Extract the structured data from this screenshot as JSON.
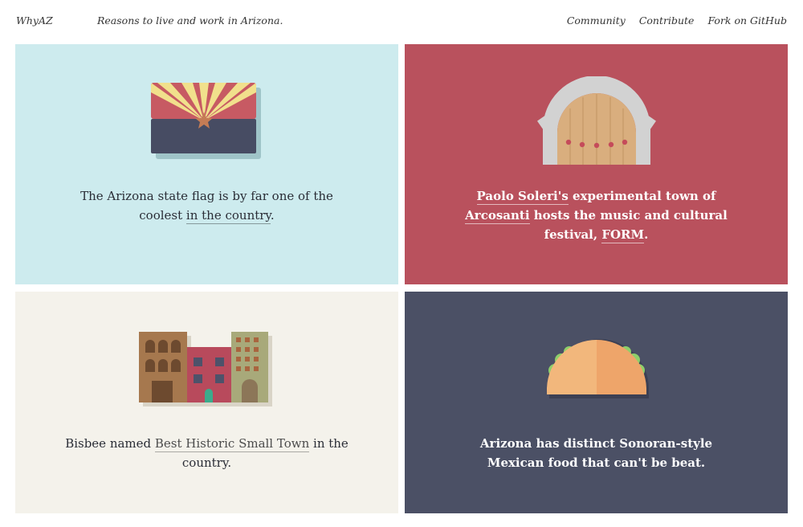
{
  "header": {
    "brand": "WhyAZ",
    "tagline": "Reasons to live and work in Arizona.",
    "nav": [
      {
        "label": "Community"
      },
      {
        "label": "Contribute"
      },
      {
        "label": "Fork on GitHub"
      }
    ]
  },
  "cards": [
    {
      "icon": "arizona-flag-icon",
      "background": "#cdebee",
      "text_before": "The Arizona state flag is by far one of the coolest ",
      "link": "in the country",
      "text_after": "."
    },
    {
      "icon": "arcosanti-bell-icon",
      "background": "#b9515d",
      "link1": "Paolo Soleri's",
      "text_mid1": " experimental town of ",
      "link2": "Arcosanti",
      "text_mid2": " hosts the music and cultural festival, ",
      "link3": "FORM",
      "text_after": "."
    },
    {
      "icon": "bisbee-buildings-icon",
      "background": "#f4f2eb",
      "text_before": "Bisbee named ",
      "link": "Best Historic Small Town",
      "text_after": " in the country."
    },
    {
      "icon": "taco-icon",
      "background": "#4b5065",
      "text": "Arizona has distinct Sonoran-style Mexican food that can't be beat."
    }
  ]
}
